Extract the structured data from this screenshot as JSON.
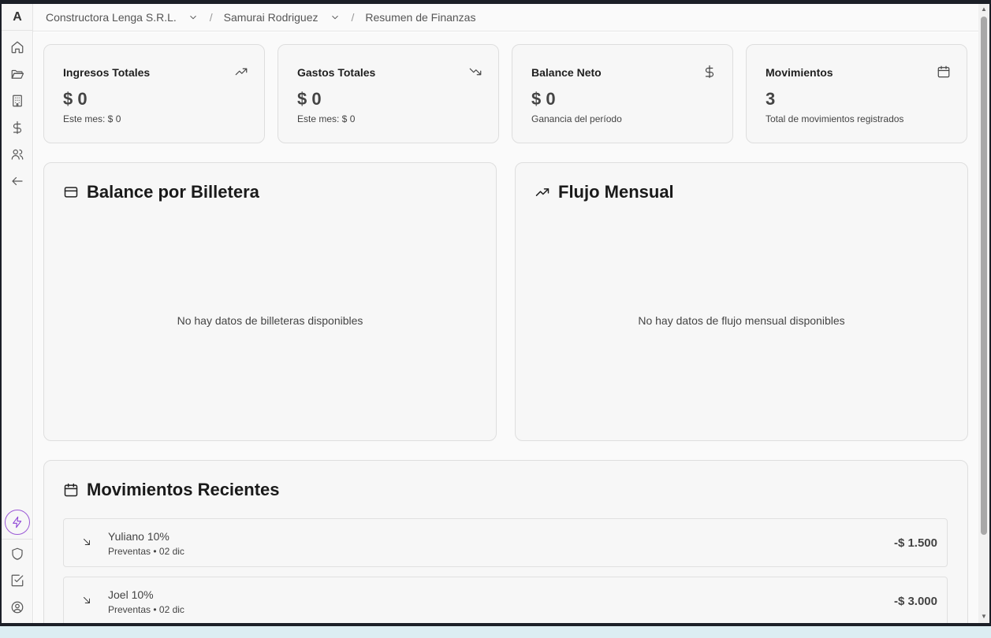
{
  "app": {
    "logo": "A"
  },
  "breadcrumb": {
    "company": "Constructora Lenga S.R.L.",
    "user": "Samurai Rodriguez",
    "page": "Resumen de Finanzas",
    "separator": "/"
  },
  "stats": [
    {
      "title": "Ingresos Totales",
      "icon": "trending-up-icon",
      "value": "$ 0",
      "sub": "Este mes: $ 0"
    },
    {
      "title": "Gastos Totales",
      "icon": "trending-down-icon",
      "value": "$ 0",
      "sub": "Este mes: $ 0"
    },
    {
      "title": "Balance Neto",
      "icon": "dollar-icon",
      "value": "$ 0",
      "sub": "Ganancia del período"
    },
    {
      "title": "Movimientos",
      "icon": "calendar-icon",
      "value": "3",
      "sub": "Total de movimientos registrados"
    }
  ],
  "wallet_panel": {
    "title": "Balance por Billetera",
    "empty": "No hay datos de billeteras disponibles"
  },
  "flow_panel": {
    "title": "Flujo Mensual",
    "empty": "No hay datos de flujo mensual disponibles"
  },
  "recent": {
    "title": "Movimientos Recientes",
    "items": [
      {
        "name": "Yuliano 10%",
        "meta": "Preventas • 02 dic",
        "amount": "-$ 1.500"
      },
      {
        "name": "Joel 10%",
        "meta": "Preventas • 02 dic",
        "amount": "-$ 3.000"
      }
    ]
  },
  "colors": {
    "accent": "#9b59d6"
  }
}
